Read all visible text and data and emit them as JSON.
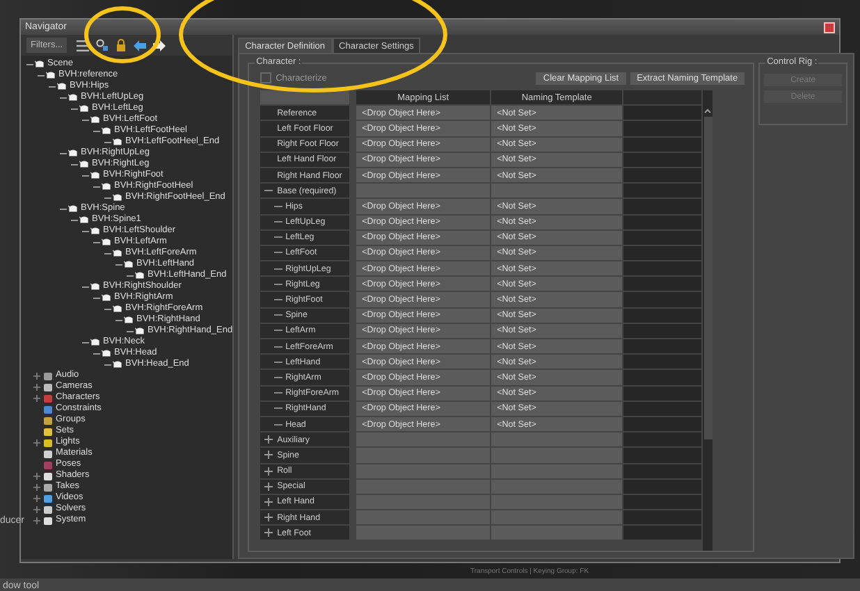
{
  "background": {
    "left_text": "ducer",
    "status_text": "Transport Controls  |  Keying Group: FK",
    "bottom_text": "dow tool"
  },
  "window": {
    "title": "Navigator"
  },
  "navigator": {
    "filter_button": "Filters...",
    "tree": [
      {
        "label": "Scene",
        "children": [
          {
            "label": "BVH:reference",
            "children": [
              {
                "label": "BVH:Hips",
                "children": [
                  {
                    "label": "BVH:LeftUpLeg",
                    "children": [
                      {
                        "label": "BVH:LeftLeg",
                        "children": [
                          {
                            "label": "BVH:LeftFoot",
                            "children": [
                              {
                                "label": "BVH:LeftFootHeel",
                                "children": [
                                  {
                                    "label": "BVH:LeftFootHeel_End"
                                  }
                                ]
                              }
                            ]
                          }
                        ]
                      }
                    ]
                  },
                  {
                    "label": "BVH:RightUpLeg",
                    "children": [
                      {
                        "label": "BVH:RightLeg",
                        "children": [
                          {
                            "label": "BVH:RightFoot",
                            "children": [
                              {
                                "label": "BVH:RightFootHeel",
                                "children": [
                                  {
                                    "label": "BVH:RightFootHeel_End"
                                  }
                                ]
                              }
                            ]
                          }
                        ]
                      }
                    ]
                  },
                  {
                    "label": "BVH:Spine",
                    "children": [
                      {
                        "label": "BVH:Spine1",
                        "children": [
                          {
                            "label": "BVH:LeftShoulder",
                            "children": [
                              {
                                "label": "BVH:LeftArm",
                                "children": [
                                  {
                                    "label": "BVH:LeftForeArm",
                                    "children": [
                                      {
                                        "label": "BVH:LeftHand",
                                        "children": [
                                          {
                                            "label": "BVH:LeftHand_End"
                                          }
                                        ]
                                      }
                                    ]
                                  }
                                ]
                              }
                            ]
                          },
                          {
                            "label": "BVH:RightShoulder",
                            "children": [
                              {
                                "label": "BVH:RightArm",
                                "children": [
                                  {
                                    "label": "BVH:RightForeArm",
                                    "children": [
                                      {
                                        "label": "BVH:RightHand",
                                        "children": [
                                          {
                                            "label": "BVH:RightHand_End"
                                          }
                                        ]
                                      }
                                    ]
                                  }
                                ]
                              }
                            ]
                          },
                          {
                            "label": "BVH:Neck",
                            "children": [
                              {
                                "label": "BVH:Head",
                                "children": [
                                  {
                                    "label": "BVH:Head_End"
                                  }
                                ]
                              }
                            ]
                          }
                        ]
                      }
                    ]
                  }
                ]
              }
            ]
          }
        ]
      }
    ],
    "categories": [
      {
        "label": "Audio",
        "expandable": true
      },
      {
        "label": "Cameras",
        "expandable": true
      },
      {
        "label": "Characters",
        "expandable": true
      },
      {
        "label": "Constraints",
        "expandable": false
      },
      {
        "label": "Groups",
        "expandable": false
      },
      {
        "label": "Sets",
        "expandable": false
      },
      {
        "label": "Lights",
        "expandable": true
      },
      {
        "label": "Materials",
        "expandable": false
      },
      {
        "label": "Poses",
        "expandable": false
      },
      {
        "label": "Shaders",
        "expandable": true
      },
      {
        "label": "Takes",
        "expandable": true
      },
      {
        "label": "Videos",
        "expandable": true
      },
      {
        "label": "Solvers",
        "expandable": true
      },
      {
        "label": "System",
        "expandable": true
      }
    ]
  },
  "tabs": [
    {
      "label": "Character Definition",
      "selected": true
    },
    {
      "label": "Character Settings",
      "selected": false
    }
  ],
  "character": {
    "group_title": "Character :",
    "characterize": {
      "label": "Characterize",
      "checked": false
    },
    "buttons": [
      "Clear Mapping List",
      "Extract Naming Template"
    ],
    "table": {
      "columns": [
        "Mapping List",
        "Naming Template"
      ],
      "rows": [
        {
          "kind": "slot",
          "label": "Reference",
          "mapping": "<Drop Object Here>",
          "naming": "<Not Set>"
        },
        {
          "kind": "slot",
          "label": "Left Foot Floor",
          "mapping": "<Drop Object Here>",
          "naming": "<Not Set>"
        },
        {
          "kind": "slot",
          "label": "Right Foot Floor",
          "mapping": "<Drop Object Here>",
          "naming": "<Not Set>"
        },
        {
          "kind": "slot",
          "label": "Left Hand Floor",
          "mapping": "<Drop Object Here>",
          "naming": "<Not Set>"
        },
        {
          "kind": "slot",
          "label": "Right Hand Floor",
          "mapping": "<Drop Object Here>",
          "naming": "<Not Set>"
        },
        {
          "kind": "group",
          "label": "Base (required)",
          "expanded": true,
          "children": [
            {
              "kind": "slot",
              "label": "Hips",
              "mapping": "<Drop Object Here>",
              "naming": "<Not Set>"
            },
            {
              "kind": "slot",
              "label": "LeftUpLeg",
              "mapping": "<Drop Object Here>",
              "naming": "<Not Set>"
            },
            {
              "kind": "slot",
              "label": "LeftLeg",
              "mapping": "<Drop Object Here>",
              "naming": "<Not Set>"
            },
            {
              "kind": "slot",
              "label": "LeftFoot",
              "mapping": "<Drop Object Here>",
              "naming": "<Not Set>"
            },
            {
              "kind": "slot",
              "label": "RightUpLeg",
              "mapping": "<Drop Object Here>",
              "naming": "<Not Set>"
            },
            {
              "kind": "slot",
              "label": "RightLeg",
              "mapping": "<Drop Object Here>",
              "naming": "<Not Set>"
            },
            {
              "kind": "slot",
              "label": "RightFoot",
              "mapping": "<Drop Object Here>",
              "naming": "<Not Set>"
            },
            {
              "kind": "slot",
              "label": "Spine",
              "mapping": "<Drop Object Here>",
              "naming": "<Not Set>"
            },
            {
              "kind": "slot",
              "label": "LeftArm",
              "mapping": "<Drop Object Here>",
              "naming": "<Not Set>"
            },
            {
              "kind": "slot",
              "label": "LeftForeArm",
              "mapping": "<Drop Object Here>",
              "naming": "<Not Set>"
            },
            {
              "kind": "slot",
              "label": "LeftHand",
              "mapping": "<Drop Object Here>",
              "naming": "<Not Set>"
            },
            {
              "kind": "slot",
              "label": "RightArm",
              "mapping": "<Drop Object Here>",
              "naming": "<Not Set>"
            },
            {
              "kind": "slot",
              "label": "RightForeArm",
              "mapping": "<Drop Object Here>",
              "naming": "<Not Set>"
            },
            {
              "kind": "slot",
              "label": "RightHand",
              "mapping": "<Drop Object Here>",
              "naming": "<Not Set>"
            },
            {
              "kind": "slot",
              "label": "Head",
              "mapping": "<Drop Object Here>",
              "naming": "<Not Set>"
            }
          ]
        },
        {
          "kind": "group",
          "label": "Auxiliary",
          "expanded": false
        },
        {
          "kind": "group",
          "label": "Spine",
          "expanded": false
        },
        {
          "kind": "group",
          "label": "Roll",
          "expanded": false
        },
        {
          "kind": "group",
          "label": "Special",
          "expanded": false
        },
        {
          "kind": "group",
          "label": "Left Hand",
          "expanded": false
        },
        {
          "kind": "group",
          "label": "Right Hand",
          "expanded": false
        },
        {
          "kind": "group",
          "label": "Left Foot",
          "expanded": false
        }
      ]
    }
  },
  "control_rig": {
    "group_title": "Control Rig :",
    "buttons": [
      {
        "label": "Create",
        "disabled": true
      },
      {
        "label": "Delete",
        "disabled": true
      }
    ]
  }
}
